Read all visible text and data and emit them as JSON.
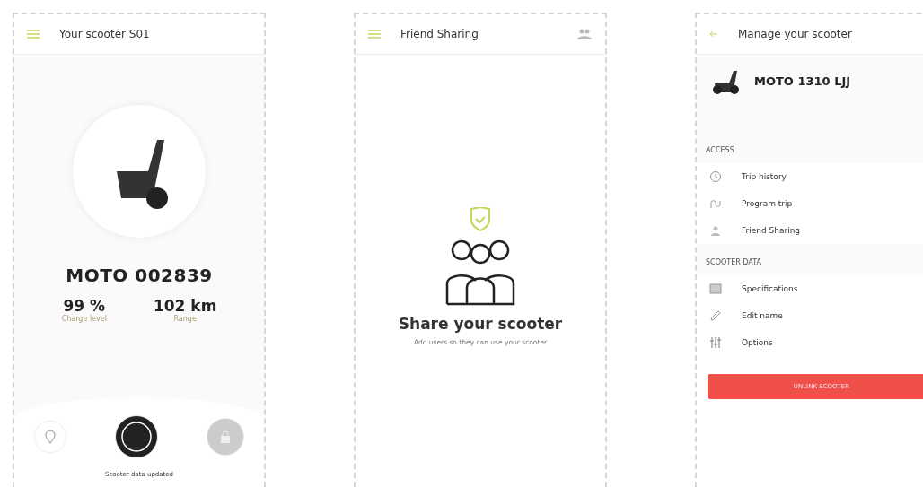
{
  "home": {
    "title": "Your scooter S01",
    "name": "MOTO 002839",
    "stats": [
      {
        "value": "99 %",
        "label": "Charge level"
      },
      {
        "value": "102 km",
        "label": "Range"
      }
    ],
    "status": "Scooter data updated"
  },
  "sharing": {
    "title": "Friend Sharing",
    "heading": "Share your scooter",
    "text": "Add users so they can use your scooter"
  },
  "manage": {
    "title": "Manage your scooter",
    "name": "MOTO 1310 LJJ",
    "sections": [
      {
        "title": "ACCESS",
        "items": [
          {
            "kind": "history",
            "label": "Trip history"
          },
          {
            "kind": "program",
            "label": "Program trip"
          },
          {
            "kind": "sharing",
            "label": "Friend Sharing"
          }
        ]
      },
      {
        "title": "SCOOTER DATA",
        "items": [
          {
            "kind": "specs",
            "label": "Specifications"
          },
          {
            "kind": "edit",
            "label": "Edit name"
          },
          {
            "kind": "options",
            "label": "Options"
          }
        ]
      }
    ],
    "button": "UNLINK SCOOTER"
  }
}
